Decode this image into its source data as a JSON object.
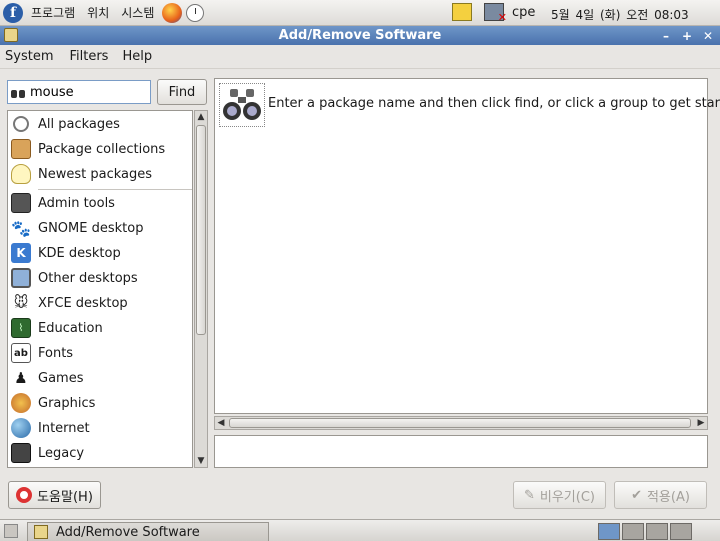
{
  "top_panel": {
    "menus": [
      "프로그램",
      "위치",
      "시스템"
    ],
    "user": "cpe",
    "clock": "5월  4일 (화) 오전 08:03"
  },
  "window": {
    "title": "Add/Remove Software",
    "menus": [
      "System",
      "Filters",
      "Help"
    ]
  },
  "search": {
    "value": "mouse",
    "find_label": "Find"
  },
  "groups": [
    {
      "label": "All packages",
      "icon": "magnifier-icon"
    },
    {
      "label": "Package collections",
      "icon": "box-icon"
    },
    {
      "label": "Newest packages",
      "icon": "lightbulb-icon"
    },
    {
      "label": "Admin tools",
      "icon": "lock-icon"
    },
    {
      "label": "GNOME desktop",
      "icon": "gnome-foot-icon"
    },
    {
      "label": "KDE desktop",
      "icon": "kde-icon"
    },
    {
      "label": "Other desktops",
      "icon": "desktop-icon"
    },
    {
      "label": "XFCE desktop",
      "icon": "xfce-mouse-icon"
    },
    {
      "label": "Education",
      "icon": "education-icon"
    },
    {
      "label": "Fonts",
      "icon": "fonts-icon"
    },
    {
      "label": "Games",
      "icon": "joystick-icon"
    },
    {
      "label": "Graphics",
      "icon": "palette-icon"
    },
    {
      "label": "Internet",
      "icon": "globe-icon"
    },
    {
      "label": "Legacy",
      "icon": "floppy-icon"
    }
  ],
  "content": {
    "hint": "Enter a package name and then click find, or click a group to get started"
  },
  "buttons": {
    "help": "도움말(H)",
    "clear": "비우기(C)",
    "apply": "적용(A)"
  },
  "taskbar": {
    "task": "Add/Remove Software"
  }
}
